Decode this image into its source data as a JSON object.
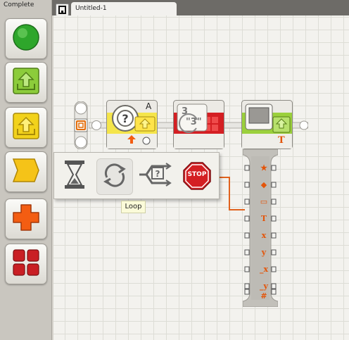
{
  "palette": {
    "title": "Complete",
    "buttons": [
      {
        "name": "palette-move-button",
        "icon": "green-circle-icon",
        "color": "#2ea62b"
      },
      {
        "name": "palette-action-button",
        "icon": "upload-arrow-icon",
        "color": "#8ccc3b"
      },
      {
        "name": "palette-sensor-button",
        "icon": "yellow-arrow-icon",
        "color": "#f2d21b"
      },
      {
        "name": "palette-flow-button",
        "icon": "flow-parallelogram-icon",
        "color": "#f5c318"
      },
      {
        "name": "palette-data-button",
        "icon": "orange-cross-icon",
        "color": "#f35d12"
      },
      {
        "name": "palette-advanced-button",
        "icon": "red-grid-icon",
        "color": "#c91f24"
      }
    ]
  },
  "tabs": {
    "document_title": "Untitled-1"
  },
  "blocks": {
    "switch_port": "A",
    "number_text": "3",
    "number_quoted": "\"3\"",
    "display_icon_letter": "T"
  },
  "popup": {
    "items": [
      "wait-hourglass-icon",
      "loop-icon",
      "switch-icon",
      "stop-icon"
    ],
    "stop_label": "STOP"
  },
  "tooltip": {
    "text": "Loop"
  },
  "display_plugs": [
    "★",
    "◆",
    "▭",
    "T",
    "x",
    "y",
    "_x",
    "_y",
    "#"
  ],
  "colors": {
    "palette_bg": "#c9c6bf",
    "grid": "#ddddd6",
    "canvas": "#f3f2ee",
    "wire": "#e0621e",
    "loop_bg": "#e6e5e1"
  }
}
